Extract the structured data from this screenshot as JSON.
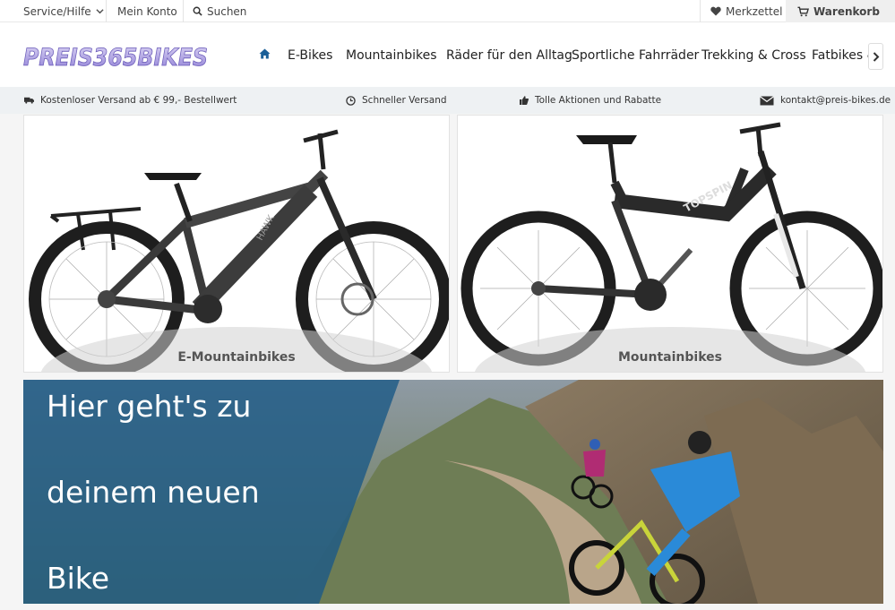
{
  "topbar": {
    "service": "Service/Hilfe",
    "account": "Mein Konto",
    "search": "Suchen",
    "wishlist": "Merkzettel",
    "cart": "Warenkorb"
  },
  "header": {
    "logo_text": "PREIS365BIKES",
    "nav": [
      "E-Bikes",
      "Mountainbikes",
      "Räder für den Alltag",
      "Sportliche Fahrräder",
      "Trekking & Cross",
      "Fatbikes &"
    ]
  },
  "usp": {
    "shipping_free": "Kostenloser Versand ab € 99,- Bestellwert",
    "fast_shipping": "Schneller Versand",
    "promotions": "Tolle Aktionen und Rabatte",
    "email": "kontakt@preis-bikes.de"
  },
  "tiles": {
    "left_label": "E-Mountainbikes",
    "right_label": "Mountainbikes"
  },
  "banner": {
    "line1": "Hier geht's zu",
    "line2": "deinem neuen",
    "line3": "Bike"
  },
  "colors": {
    "accent_blue": "#1a6fb0",
    "banner_overlay": "#1d5a86",
    "usp_bg": "#eef1f3"
  }
}
